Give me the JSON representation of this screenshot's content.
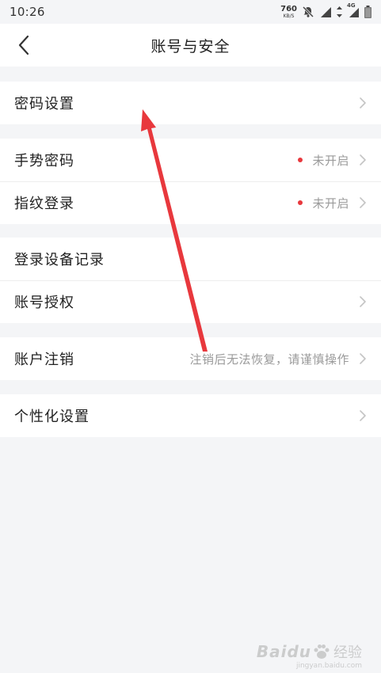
{
  "status_bar": {
    "time": "10:26",
    "net_speed_value": "760",
    "net_speed_unit": "KB/S",
    "network_type": "4G",
    "icons": [
      "mute-bell-icon",
      "wifi-signal-icon",
      "data-arrows-icon",
      "cell-signal-icon",
      "battery-icon"
    ]
  },
  "header": {
    "title": "账号与安全",
    "back_icon": "chevron-left-icon"
  },
  "groups": [
    {
      "items": [
        {
          "label": "密码设置",
          "value": "",
          "has_dot": false,
          "has_chevron": true
        }
      ]
    },
    {
      "items": [
        {
          "label": "手势密码",
          "value": "未开启",
          "has_dot": true,
          "has_chevron": true
        },
        {
          "label": "指纹登录",
          "value": "未开启",
          "has_dot": true,
          "has_chevron": true
        }
      ]
    },
    {
      "items": [
        {
          "label": "登录设备记录",
          "value": "",
          "has_dot": false,
          "has_chevron": false
        },
        {
          "label": "账号授权",
          "value": "",
          "has_dot": false,
          "has_chevron": true
        }
      ]
    },
    {
      "items": [
        {
          "label": "账户注销",
          "value": "注销后无法恢复，请谨慎操作",
          "has_dot": false,
          "has_chevron": true
        }
      ]
    },
    {
      "items": [
        {
          "label": "个性化设置",
          "value": "",
          "has_dot": false,
          "has_chevron": true
        }
      ]
    }
  ],
  "watermark": {
    "logo": "Baidu",
    "jingyan": "经验",
    "domain": "jingyan.baidu.com"
  },
  "colors": {
    "background": "#f4f5f7",
    "card": "#ffffff",
    "dot": "#e8383d",
    "value_text": "#9a9a9a",
    "annotation_arrow": "#e8383d"
  }
}
